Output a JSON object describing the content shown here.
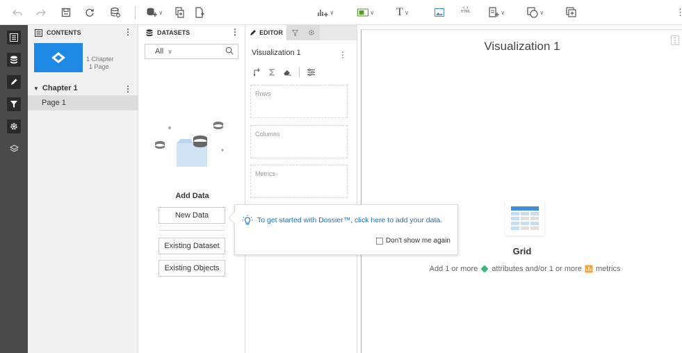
{
  "toolbar": {
    "right_kebab": "⋮",
    "text_tool": "T",
    "html_tool": "HTML"
  },
  "contents": {
    "header": "CONTENTS",
    "thumb_meta": [
      "1 Chapter",
      "1 Page"
    ],
    "chapter": "Chapter 1",
    "page": "Page 1",
    "kebab": "⋮"
  },
  "datasets": {
    "header": "DATASETS",
    "filter_value": "All",
    "add_data_title": "Add Data",
    "new_data": "New Data",
    "existing_dataset": "Existing Dataset",
    "existing_objects": "Existing Objects",
    "kebab": "⋮"
  },
  "editor": {
    "tab_editor": "EDITOR",
    "viz_name": "Visualization 1",
    "kebab": "⋮",
    "drop_rows": "Rows",
    "drop_columns": "Columns",
    "drop_metrics": "Metrics"
  },
  "canvas": {
    "title": "Visualization 1",
    "kebab": "⋮",
    "grid_label": "Grid",
    "hint_prefix": "Add 1 or more",
    "hint_attr": "attributes and/or 1 or more",
    "hint_metrics": "metrics"
  },
  "popup": {
    "message": "To get started with Dossier™, click here to add your data.",
    "checkbox_label": "Don't show me again"
  },
  "colors": {
    "accent": "#1e88e5",
    "rail": "#4a4a4a",
    "link": "#1a73c8",
    "attribute": "#3db37a",
    "metric": "#f2a33a"
  }
}
